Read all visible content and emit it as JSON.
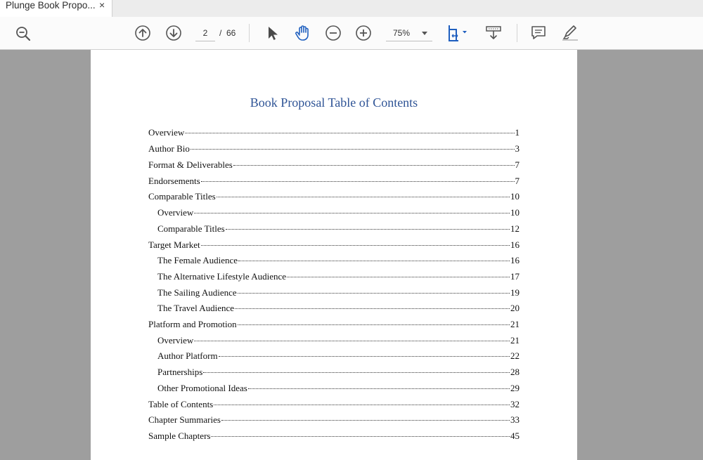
{
  "tab": {
    "title": "Plunge Book Propo...",
    "close": "×"
  },
  "toolbar": {
    "current_page": "2",
    "separator": "/",
    "total_pages": "66",
    "zoom": "75%"
  },
  "icons": [
    "zoom-out-magnifier-icon",
    "previous-page-icon",
    "next-page-icon",
    "select-cursor-icon",
    "hand-tool-icon",
    "zoom-out-icon",
    "zoom-in-icon",
    "dropdown-caret-icon",
    "page-fit-icon",
    "scrolling-mode-icon",
    "comment-icon",
    "highlight-pen-icon"
  ],
  "accent_color": "#1f5fbf",
  "document": {
    "title": "Book Proposal Table of Contents",
    "toc": [
      {
        "label": "Overview",
        "page": "1",
        "level": 1
      },
      {
        "label": "Author Bio",
        "page": "3",
        "level": 1
      },
      {
        "label": "Format & Deliverables",
        "page": "7",
        "level": 1
      },
      {
        "label": "Endorsements",
        "page": "7",
        "level": 1
      },
      {
        "label": "Comparable Titles",
        "page": "10",
        "level": 1
      },
      {
        "label": "Overview",
        "page": "10",
        "level": 2
      },
      {
        "label": "Comparable Titles",
        "page": "12",
        "level": 2
      },
      {
        "label": "Target Market",
        "page": "16",
        "level": 1
      },
      {
        "label": "The Female Audience",
        "page": "16",
        "level": 2
      },
      {
        "label": "The Alternative Lifestyle Audience",
        "page": "17",
        "level": 2
      },
      {
        "label": "The Sailing Audience",
        "page": "19",
        "level": 2
      },
      {
        "label": "The Travel Audience",
        "page": "20",
        "level": 2
      },
      {
        "label": "Platform and Promotion",
        "page": "21",
        "level": 1
      },
      {
        "label": "Overview",
        "page": "21",
        "level": 2
      },
      {
        "label": "Author Platform",
        "page": "22",
        "level": 2
      },
      {
        "label": "Partnerships",
        "page": "28",
        "level": 2
      },
      {
        "label": "Other Promotional Ideas",
        "page": "29",
        "level": 2
      },
      {
        "label": "Table of Contents",
        "page": "32",
        "level": 1
      },
      {
        "label": "Chapter Summaries",
        "page": "33",
        "level": 1
      },
      {
        "label": "Sample Chapters",
        "page": "45",
        "level": 1
      }
    ]
  }
}
